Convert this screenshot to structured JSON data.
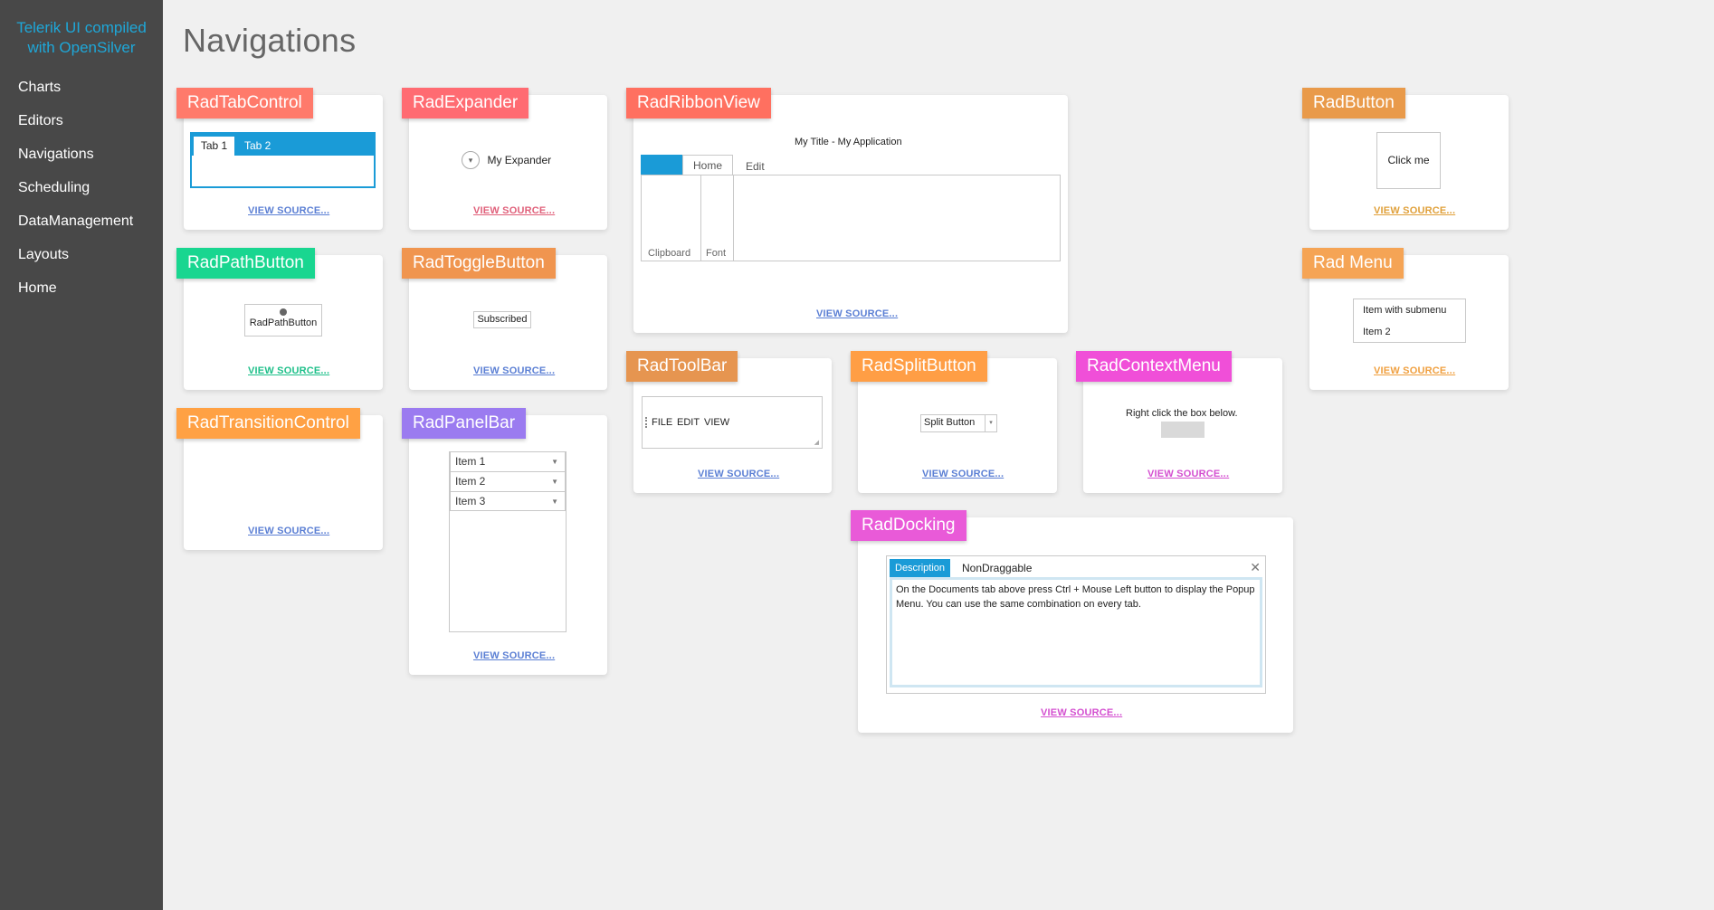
{
  "sidebar": {
    "brand_line1": "Telerik UI compiled",
    "brand_line2": "with OpenSilver",
    "items": [
      {
        "label": "Charts"
      },
      {
        "label": "Editors"
      },
      {
        "label": "Navigations"
      },
      {
        "label": "Scheduling"
      },
      {
        "label": "DataManagement"
      },
      {
        "label": "Layouts"
      },
      {
        "label": "Home"
      }
    ]
  },
  "page": {
    "title": "Navigations"
  },
  "view_source_label": "VIEW SOURCE...",
  "cards": {
    "tabcontrol": {
      "label": "RadTabControl",
      "color": "#ff7a6b",
      "link_color": "#5b7fd4",
      "tab1": "Tab 1",
      "tab2": "Tab 2"
    },
    "expander": {
      "label": "RadExpander",
      "color": "#ff6b72",
      "link_color": "#e0607a",
      "text": "My Expander"
    },
    "ribbonview": {
      "label": "RadRibbonView",
      "color": "#ff7060",
      "link_color": "#5b7fd4",
      "title": "My Title - My Application",
      "tab_home": "Home",
      "tab_edit": "Edit",
      "group_clipboard": "Clipboard",
      "group_font": "Font"
    },
    "button": {
      "label": "RadButton",
      "color": "#e99a4a",
      "link_color": "#e0a03a",
      "text": "Click me"
    },
    "pathbutton": {
      "label": "RadPathButton",
      "color": "#19d690",
      "link_color": "#1fc08a",
      "text": "RadPathButton"
    },
    "togglebutton": {
      "label": "RadToggleButton",
      "color": "#f0954f",
      "link_color": "#5b7fd4",
      "text": "Subscribed"
    },
    "menu": {
      "label": "Rad Menu",
      "color": "#f5a455",
      "link_color": "#f0a040",
      "item1": "Item with submenu",
      "item2": "Item 2"
    },
    "toolbar": {
      "label": "RadToolBar",
      "color": "#e69550",
      "link_color": "#5b7fd4",
      "file": "FILE",
      "edit": "EDIT",
      "view": "VIEW"
    },
    "splitbutton": {
      "label": "RadSplitButton",
      "color": "#ff9e45",
      "link_color": "#5b7fd4",
      "text": "Split Button"
    },
    "contextmenu": {
      "label": "RadContextMenu",
      "color": "#f04fd8",
      "link_color": "#d44fd0",
      "text": "Right click the box below."
    },
    "transitioncontrol": {
      "label": "RadTransitionControl",
      "color": "#ffa144",
      "link_color": "#5b7fd4"
    },
    "panelbar": {
      "label": "RadPanelBar",
      "color": "#9b7bf0",
      "link_color": "#5b7fd4",
      "items": [
        "Item 1",
        "Item 2",
        "Item 3"
      ]
    },
    "docking": {
      "label": "RadDocking",
      "color": "#e95ad8",
      "link_color": "#d44fd0",
      "tab_active": "Description",
      "tab_other": "NonDraggable",
      "body": "On the Documents tab above press Ctrl + Mouse Left button to display the Popup Menu. You can use the same combination on every tab."
    }
  }
}
